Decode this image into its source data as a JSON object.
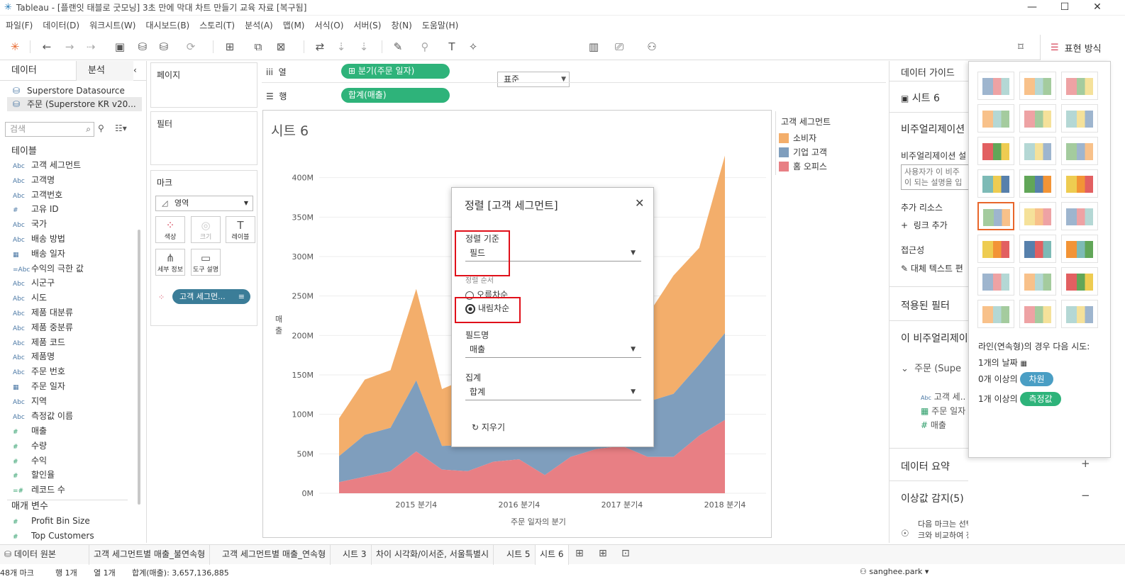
{
  "window": {
    "title": "Tableau - [플랜잇 태블로 굿모닝] 3초 만에 막대 차트 만들기 교육 자료 [복구됨]",
    "min": "—",
    "max": "☐",
    "close": "✕"
  },
  "menu": [
    "파일(F)",
    "데이터(D)",
    "워크시트(W)",
    "대시보드(B)",
    "스토리(T)",
    "분석(A)",
    "맵(M)",
    "서식(O)",
    "서버(S)",
    "창(N)",
    "도움말(H)"
  ],
  "toolbar": {
    "fit": "표준",
    "showme": "표현 방식"
  },
  "left": {
    "tabs": [
      "데이터",
      "분석"
    ],
    "datasources": [
      "Superstore Datasource",
      "주문 (Superstore KR v20..."
    ],
    "search_placeholder": "검색",
    "tables_label": "테이블",
    "dimensions": [
      {
        "icon": "Abc",
        "name": "고객 세그먼트"
      },
      {
        "icon": "Abc",
        "name": "고객명"
      },
      {
        "icon": "Abc",
        "name": "고객번호"
      },
      {
        "icon": "#",
        "name": "고유 ID"
      },
      {
        "icon": "Abc",
        "name": "국가"
      },
      {
        "icon": "Abc",
        "name": "배송 방법"
      },
      {
        "icon": "▦",
        "name": "배송 일자"
      },
      {
        "icon": "=Abc",
        "name": "수익의 극한 값"
      },
      {
        "icon": "Abc",
        "name": "시군구"
      },
      {
        "icon": "Abc",
        "name": "시도"
      },
      {
        "icon": "Abc",
        "name": "제품 대분류"
      },
      {
        "icon": "Abc",
        "name": "제품 중분류"
      },
      {
        "icon": "Abc",
        "name": "제품 코드"
      },
      {
        "icon": "Abc",
        "name": "제품명"
      },
      {
        "icon": "Abc",
        "name": "주문 번호"
      },
      {
        "icon": "▦",
        "name": "주문 일자"
      },
      {
        "icon": "Abc",
        "name": "지역"
      },
      {
        "icon": "Abc",
        "name": "측정값 이름"
      }
    ],
    "measures": [
      {
        "icon": "#",
        "name": "매출"
      },
      {
        "icon": "#",
        "name": "수량"
      },
      {
        "icon": "#",
        "name": "수익"
      },
      {
        "icon": "#",
        "name": "할인율"
      },
      {
        "icon": "=#",
        "name": "레코드 수"
      }
    ],
    "params_label": "매개 변수",
    "params": [
      {
        "icon": "#",
        "name": "Profit Bin Size"
      },
      {
        "icon": "#",
        "name": "Top Customers"
      }
    ]
  },
  "shelves": {
    "pages": "페이지",
    "filters": "필터",
    "marks": "마크",
    "mark_type": "영역",
    "mark_buttons": [
      "색상",
      "크기",
      "레이블",
      "세부 정보",
      "도구 설명"
    ],
    "mark_pill": "고객 세그먼...",
    "columns_label": "열",
    "columns_pill": "⊞ 분기(주문 일자)",
    "rows_label": "행",
    "rows_pill": "합계(매출)"
  },
  "chart": {
    "sheet_title": "시트 6",
    "x_axis_title": "주문 일자의 분기",
    "y_axis_title": "매출"
  },
  "chart_data": {
    "type": "area",
    "stacked": true,
    "title": "시트 6",
    "xlabel": "주문 일자의 분기",
    "ylabel": "매출",
    "ylim": [
      0,
      450
    ],
    "y_unit": "M",
    "y_ticks": [
      "0M",
      "50M",
      "100M",
      "150M",
      "200M",
      "250M",
      "300M",
      "350M",
      "400M"
    ],
    "x_tick_labels": [
      "2015 분기4",
      "2016 분기4",
      "2017 분기4",
      "2018 분기4"
    ],
    "legend_position": "right",
    "series": [
      {
        "name": "홈 오피스",
        "color": "#e87f84",
        "values": [
          14,
          21,
          28,
          53,
          30,
          28,
          40,
          43,
          23,
          46,
          56,
          60,
          46,
          46,
          73,
          93
        ]
      },
      {
        "name": "기업 고객",
        "color": "#7f9ebd",
        "values": [
          33,
          53,
          55,
          90,
          30,
          33,
          58,
          59,
          83,
          67,
          58,
          75,
          70,
          80,
          90,
          110
        ]
      },
      {
        "name": "소비자",
        "color": "#f3ae6b",
        "values": [
          48,
          70,
          73,
          116,
          72,
          85,
          117,
          112,
          145,
          125,
          140,
          110,
          110,
          150,
          148,
          225
        ]
      }
    ]
  },
  "legend": {
    "title": "고객 세그먼트",
    "items": [
      {
        "name": "소비자",
        "color": "#f3ae6b"
      },
      {
        "name": "기업 고객",
        "color": "#7f9ebd"
      },
      {
        "name": "홈 오피스",
        "color": "#e87f84"
      }
    ]
  },
  "dialog": {
    "title": "정렬 [고객 세그먼트]",
    "close": "✕",
    "sort_by_label": "정렬 기준",
    "sort_by_value": "필드",
    "order_label": "정렬 순서",
    "asc": "오름차순",
    "desc": "내림차순",
    "field_label": "필드명",
    "field_value": "매출",
    "agg_label": "집계",
    "agg_value": "합계",
    "clear": "↻ 지우기"
  },
  "right": {
    "header": "데이터 가이드",
    "sheet": "시트 6",
    "viz_desc": "비주얼리제이션",
    "viz_desc2": "비주얼리제이션 설",
    "placeholder1": "사용자가 이 비주",
    "placeholder2": "이 되는 설명을 입",
    "resources": "추가 리소스",
    "add_link": "링크 추가",
    "accessibility": "접근성",
    "alt_text": "대체 텍스트 편",
    "filters_applied": "적용된 필터",
    "this_viz": "이 비주얼리제이",
    "tree_root": "주문 (Supe",
    "tree_items": [
      "고객 세..",
      "주문 일자",
      "매출"
    ],
    "data_summary": "데이터 요약",
    "outliers": "이상값 감지(5)",
    "outlier_text1": "다음 마크는 선택한 비주얼리제이션의 다른 마",
    "outlier_text2": "크와 비교하여 정상이 아닌 것으로 감지되었습"
  },
  "showme": {
    "hint_line": "라인(연속형)의 경우 다음 시도:",
    "hint1": "1개의 날짜",
    "hint2_pre": "0개 이상의",
    "hint2_pill": "차원",
    "hint3_pre": "1개 이상의",
    "hint3_pill": "측정값",
    "dim_color": "#4a9ec4",
    "meas_color": "#2eb37a"
  },
  "sheet_tabs": [
    "데이터 원본",
    "고객 세그먼트별 매출_불연속형",
    "고객 세그먼트별 매출_연속형",
    "시트 3",
    "차이 시각화/이서준, 서울특별시",
    "시트 5",
    "시트 6"
  ],
  "status": {
    "marks": "48개 마크",
    "rows": "행 1개",
    "cols": "열 1개",
    "sum": "합계(매출): 3,657,136,885",
    "user": "sanghee.park"
  }
}
